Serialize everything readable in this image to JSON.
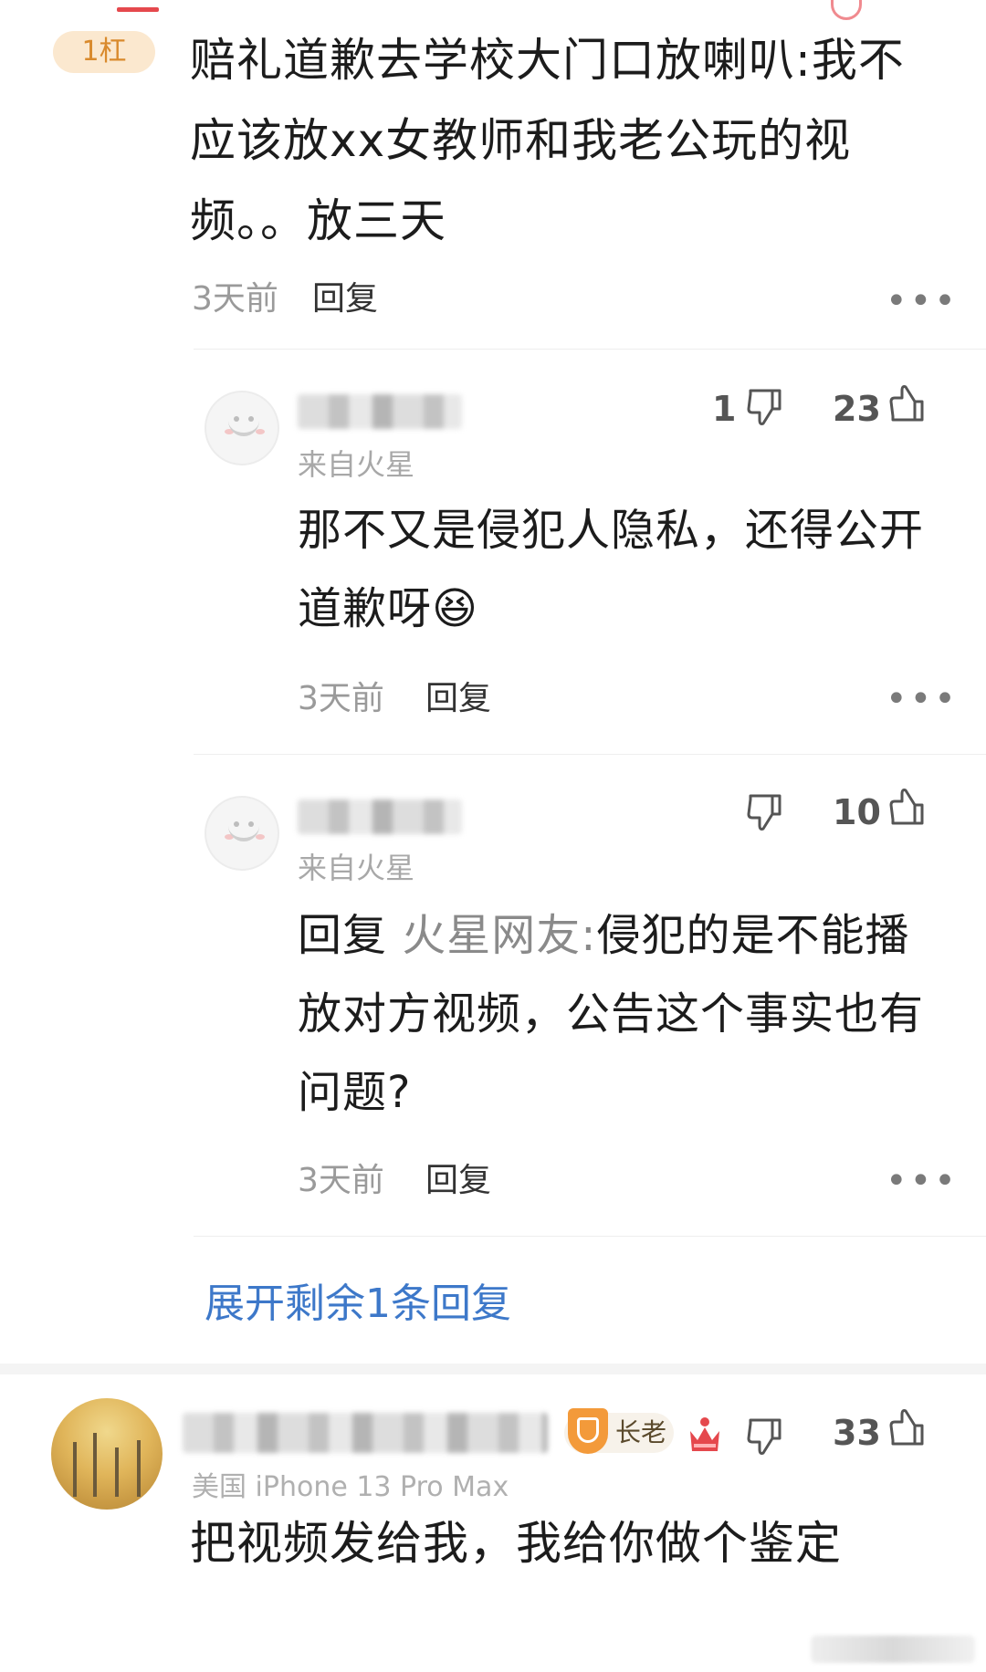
{
  "top_comment": {
    "floor_badge": "1杠",
    "text": "赔礼道歉去学校大门口放喇叭:我不应该放xx女教师和我老公玩的视频。。放三天",
    "time": "3天前",
    "reply_label": "回复",
    "more": "•••"
  },
  "replies": [
    {
      "source": "来自火星",
      "dislike_count": "1",
      "like_count": "23",
      "text": "那不又是侵犯人隐私，还得公开道歉呀",
      "emoji": "😆",
      "time": "3天前",
      "reply_label": "回复",
      "more": "•••"
    },
    {
      "source": "来自火星",
      "dislike_count": "",
      "like_count": "10",
      "prefix": "回复",
      "mention": "火星网友:",
      "text": "侵犯的是不能播放对方视频，公告这个事实也有问题?",
      "time": "3天前",
      "reply_label": "回复",
      "more": "•••"
    }
  ],
  "expand_label": "展开剩余1条回复",
  "bottom_comment": {
    "badge": "长老",
    "device": "美国 iPhone 13 Pro Max",
    "like_count": "33",
    "text": "把视频发给我，我给你做个鉴定"
  },
  "colors": {
    "link_blue": "#3d78c9",
    "badge_orange": "#d98a2d",
    "badge_bg": "#fbe8cf"
  }
}
